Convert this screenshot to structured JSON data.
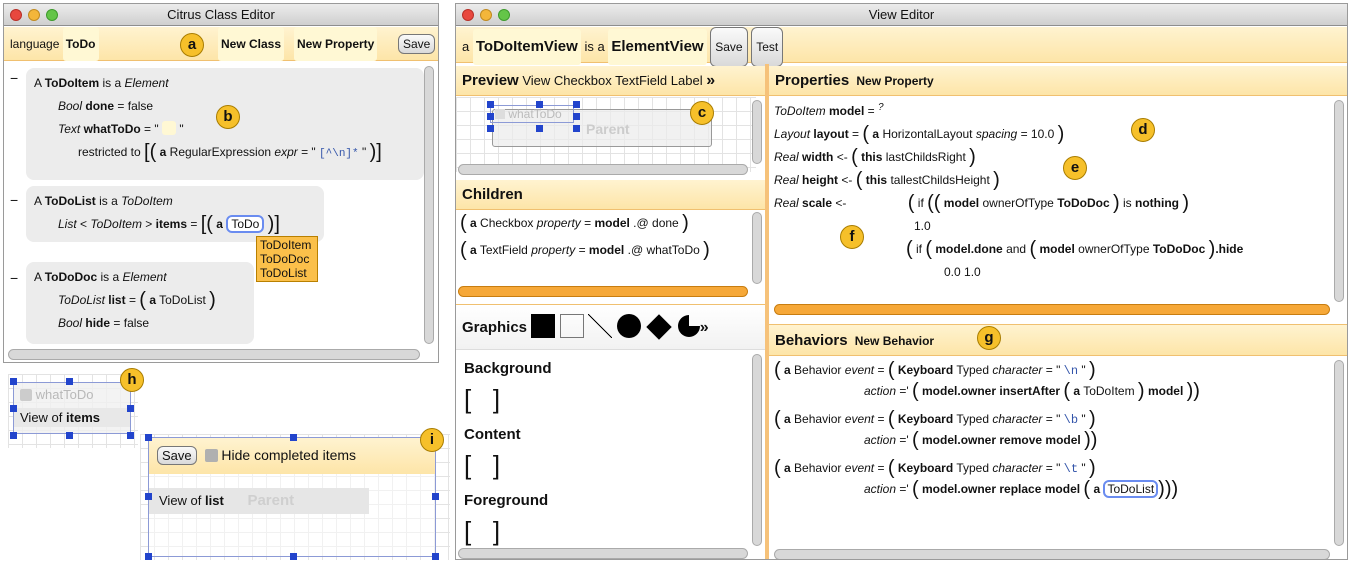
{
  "left_window": {
    "title": "Citrus Class Editor",
    "language_label": "language",
    "language_value": "ToDo",
    "new_class": "New Class",
    "new_property": "New Property",
    "save": "Save",
    "class1": {
      "name": "ToDoItem",
      "is_a": "is a",
      "base": "Element",
      "p1_type": "Bool",
      "p1_name": "done",
      "p1_value": "false",
      "p2_type": "Text",
      "p2_name": "whatToDo",
      "restricted": "restricted to",
      "re_type": "RegularExpression",
      "re_prop": "expr",
      "re_value": "[^\\n]*"
    },
    "class2": {
      "name": "ToDoList",
      "is_a": "is a",
      "base": "ToDoItem",
      "p_type": "List",
      "p_generic": "ToDoItem",
      "p_name": "items",
      "p_value": "ToDo"
    },
    "dropdown": [
      "ToDoItem",
      "ToDoDoc",
      "ToDoList"
    ],
    "class3": {
      "name": "ToDoDoc",
      "is_a": "is a",
      "base": "Element",
      "p1_type": "ToDoList",
      "p1_name": "list",
      "p1_value": "ToDoList",
      "p2_type": "Bool",
      "p2_name": "hide",
      "p2_value": "false"
    }
  },
  "badges": [
    "a",
    "b",
    "c",
    "d",
    "e",
    "f",
    "g",
    "h",
    "i"
  ],
  "minus": "−",
  "article": "A",
  "article_lower": "a",
  "preview_h": {
    "checkbox_label": "whatToDo",
    "view_of": "View of",
    "view_target": "items"
  },
  "preview_i": {
    "save": "Save",
    "checkbox_label": "Hide completed items",
    "view_of": "View of",
    "view_target": "list",
    "parent": "Parent"
  },
  "right_window": {
    "title": "View Editor",
    "view_name": "ToDoItemView",
    "is_a": "is a",
    "view_base": "ElementView",
    "save": "Save",
    "test": "Test",
    "preview": {
      "title": "Preview",
      "tabs": [
        "View",
        "Checkbox",
        "TextField",
        "Label"
      ],
      "more": "»",
      "checkbox_label": "whatToDo",
      "parent": "Parent"
    },
    "children": {
      "title": "Children",
      "rows": [
        {
          "type": "Checkbox",
          "prop": "property",
          "model": "model",
          "path": ".@ done"
        },
        {
          "type": "TextField",
          "prop": "property",
          "model": "model",
          "path": ".@ whatToDo"
        }
      ]
    },
    "graphics": {
      "title": "Graphics",
      "more": "»",
      "sections": [
        "Background",
        "Content",
        "Foreground"
      ]
    },
    "properties": {
      "title": "Properties",
      "new_property": "New Property",
      "l1": {
        "type": "ToDoItem",
        "name": "model",
        "value": "?"
      },
      "l2": {
        "type": "Layout",
        "name": "layout",
        "ctor": "HorizontalLayout",
        "attr": "spacing",
        "value": "10.0"
      },
      "l3": {
        "type": "Real",
        "name": "width",
        "arrow": "<-",
        "this": "this",
        "method": "lastChildsRight"
      },
      "l4": {
        "type": "Real",
        "name": "height",
        "arrow": "<-",
        "this": "this",
        "method": "tallestChildsHeight"
      },
      "l5": {
        "type": "Real",
        "name": "scale",
        "arrow": "<-",
        "if": "if",
        "model": "model",
        "method": "ownerOfType",
        "arg": "ToDoDoc",
        "is": "is",
        "nothing": "nothing"
      },
      "l6": "1.0",
      "l7": {
        "if": "if",
        "model": "model",
        "done": ".done",
        "and": "and",
        "method": "ownerOfType",
        "arg": "ToDoDoc",
        "hide": ".hide"
      },
      "l8": "0.0  1.0"
    },
    "behaviors": {
      "title": "Behaviors",
      "new_behavior": "New Behavior",
      "type": "Behavior",
      "event": "event",
      "action": "action",
      "keyboard": "Keyboard",
      "typed": "Typed",
      "character": "character",
      "b1": {
        "char": "\\n",
        "action": "model.owner insertAfter",
        "arg": "ToDoItem",
        "tail": "model"
      },
      "b2": {
        "char": "\\b",
        "action": "model.owner remove",
        "tail": "model"
      },
      "b3": {
        "char": "\\t",
        "action": "model.owner replace",
        "mid": "model",
        "arg": "ToDoList"
      }
    }
  },
  "colors": {
    "accent": "#f6c02a",
    "strip": "#fde5a8",
    "handle": "#2244cc",
    "scroll_active": "#f6a838"
  }
}
